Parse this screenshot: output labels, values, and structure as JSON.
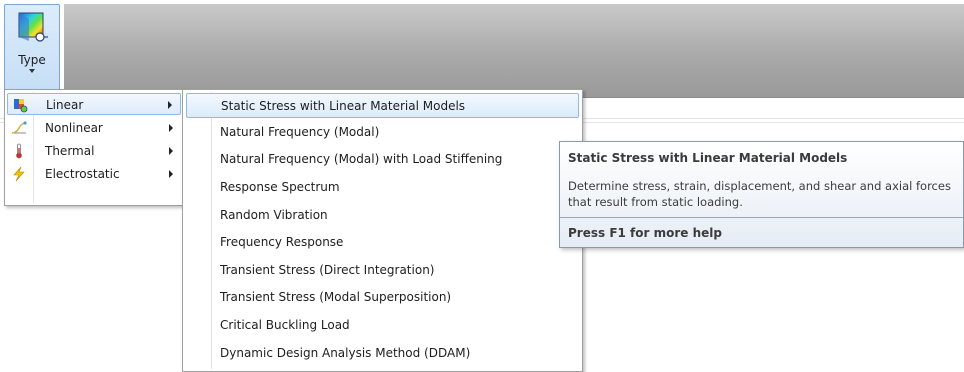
{
  "ribbon": {
    "type_button_label": "Type"
  },
  "left_menu": {
    "items": [
      {
        "label": "Linear",
        "icon": "linear-icon",
        "selected": true
      },
      {
        "label": "Nonlinear",
        "icon": "nonlinear-icon",
        "selected": false
      },
      {
        "label": "Thermal",
        "icon": "thermometer-icon",
        "selected": false
      },
      {
        "label": "Electrostatic",
        "icon": "lightning-icon",
        "selected": false
      }
    ]
  },
  "submenu": {
    "items": [
      {
        "label": "Static Stress with Linear Material Models",
        "selected": true
      },
      {
        "label": "Natural Frequency (Modal)"
      },
      {
        "label": "Natural Frequency (Modal) with Load Stiffening"
      },
      {
        "label": "Response Spectrum"
      },
      {
        "label": "Random Vibration"
      },
      {
        "label": "Frequency Response"
      },
      {
        "label": "Transient Stress (Direct Integration)"
      },
      {
        "label": "Transient Stress (Modal Superposition)"
      },
      {
        "label": "Critical Buckling Load"
      },
      {
        "label": "Dynamic Design Analysis Method (DDAM)"
      }
    ]
  },
  "tooltip": {
    "title": "Static Stress with Linear Material Models",
    "description": "Determine stress, strain, displacement, and shear and axial forces that result from static loading.",
    "help": "Press F1 for more help"
  },
  "colors": {
    "selection_border": "#90b9e6",
    "ribbon_gray": "#a9a9a9"
  }
}
